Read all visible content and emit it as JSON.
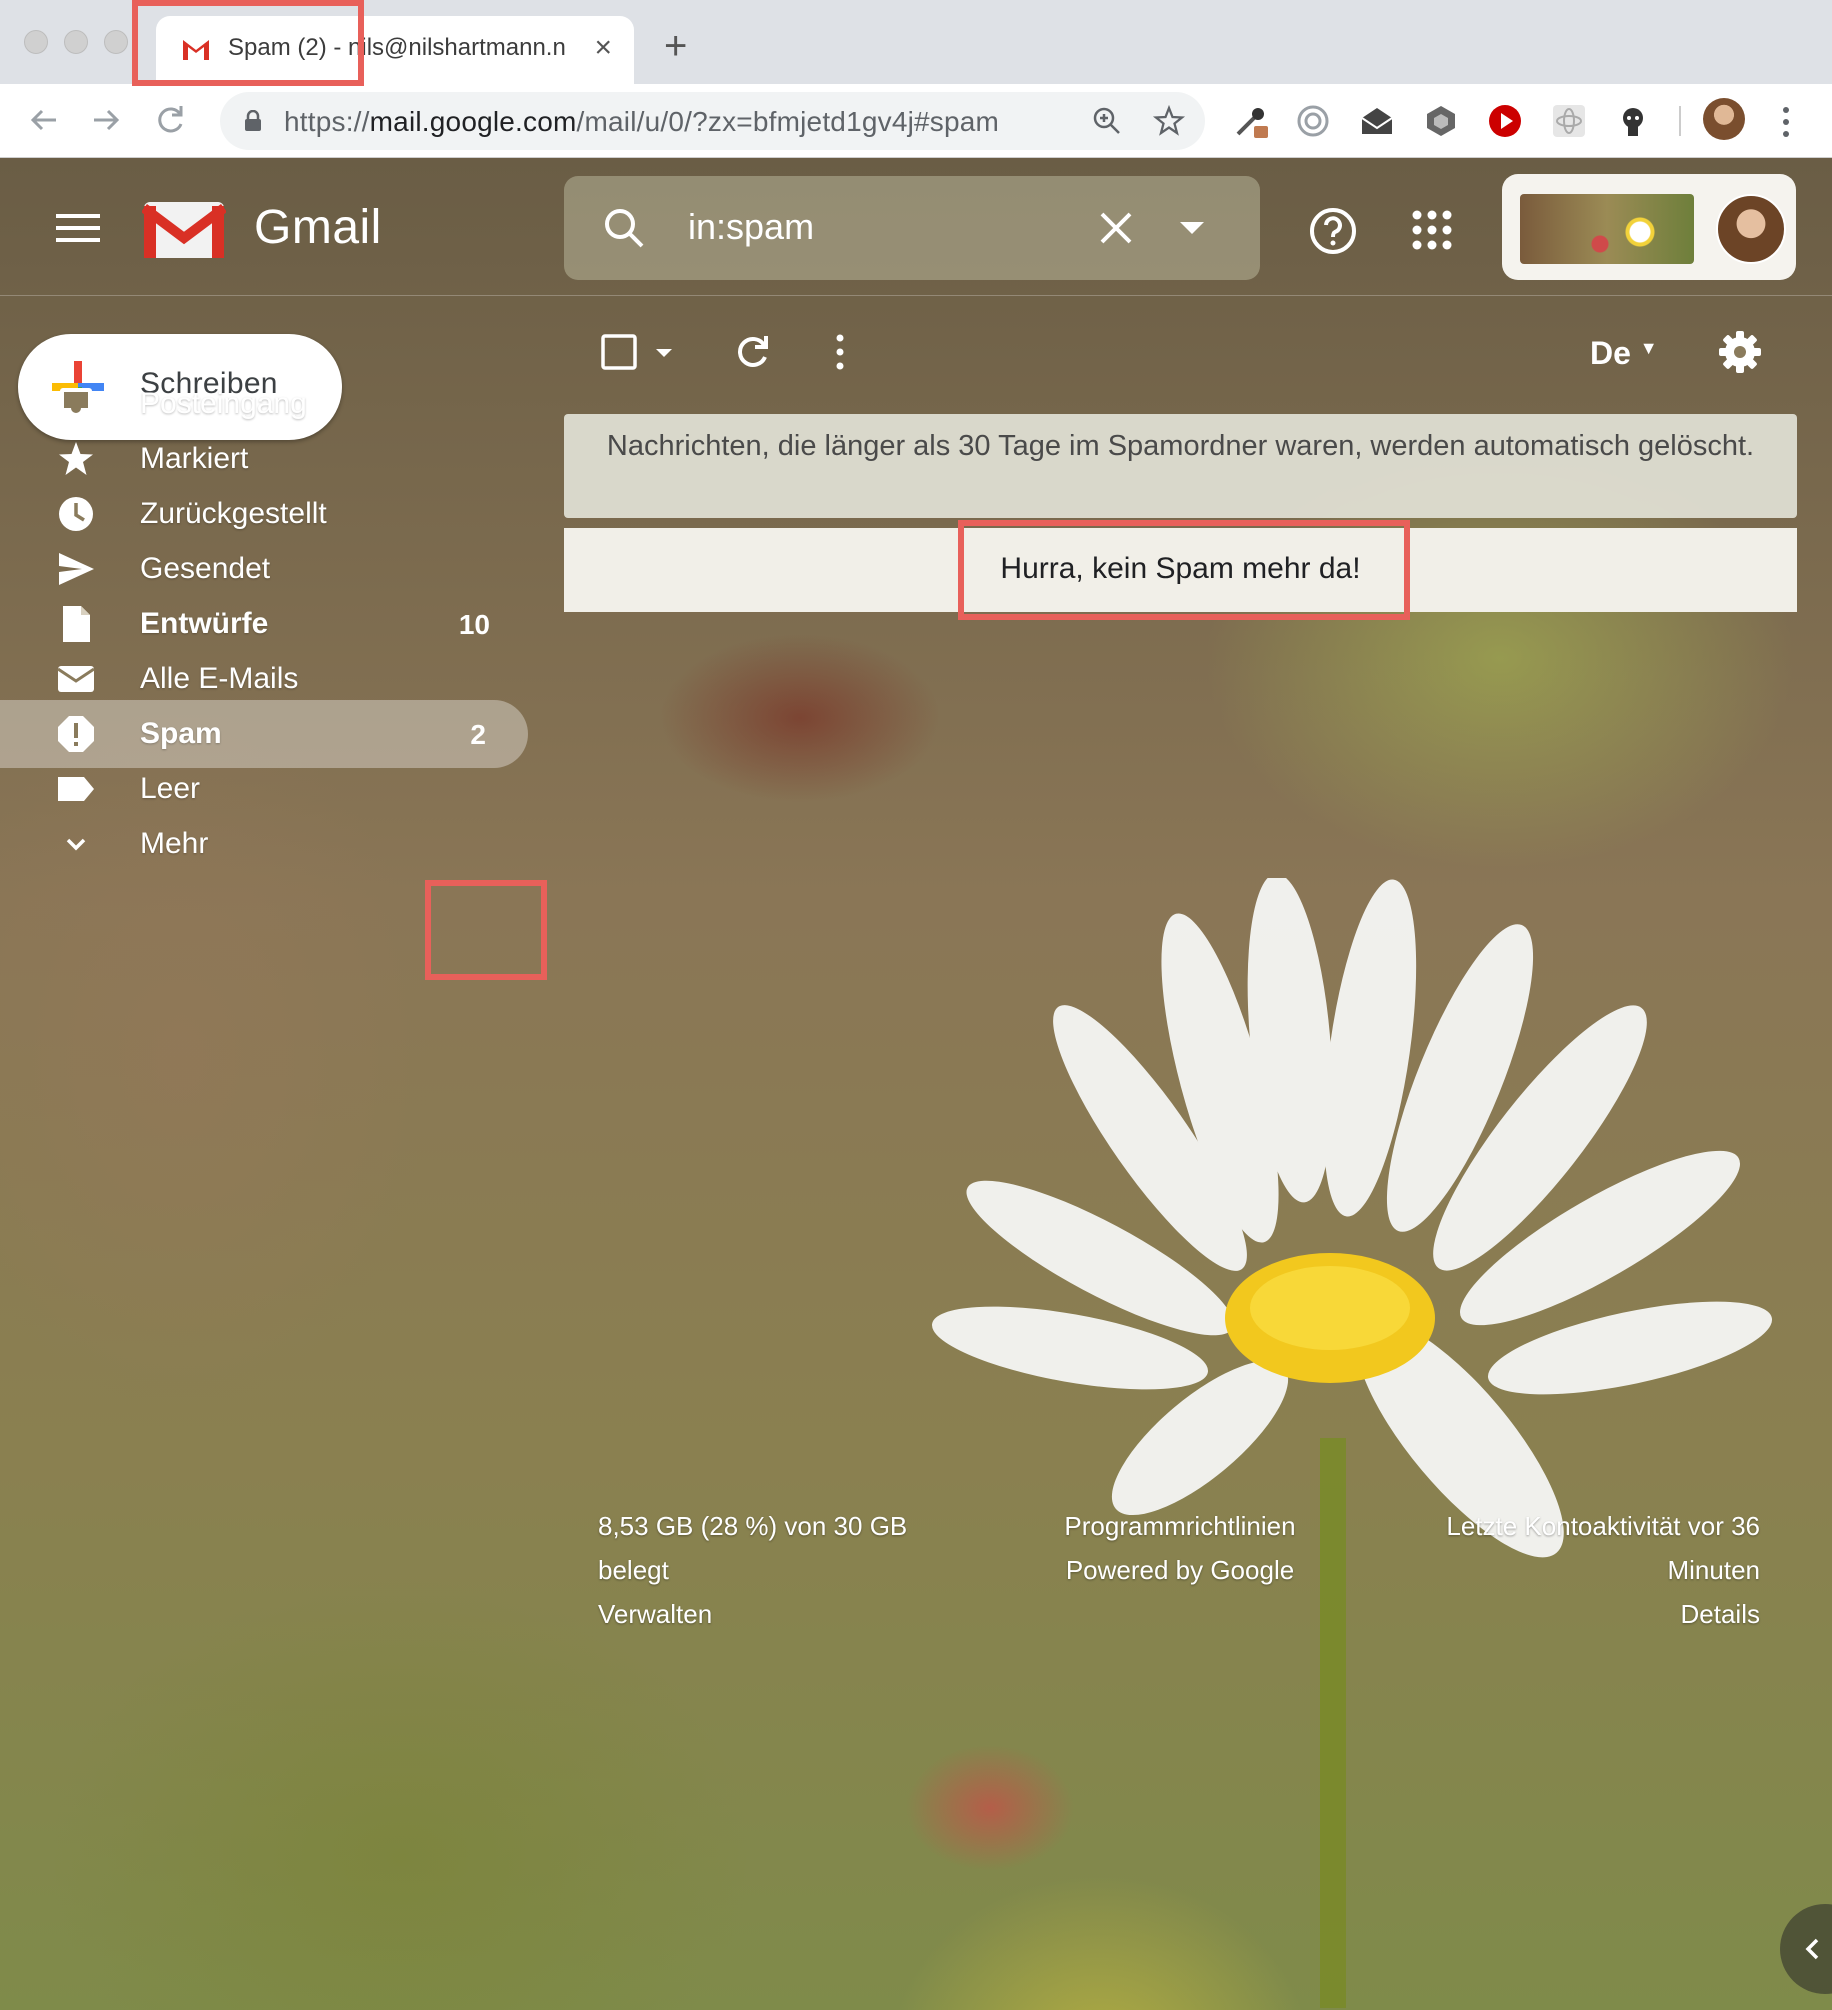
{
  "browser": {
    "tab": {
      "title": "Spam (2) - nils@nilshartmann.n",
      "close": "×"
    },
    "new_tab": "+",
    "url": {
      "scheme": "https://",
      "host": "mail.google.com",
      "path": "/mail/u/0/?zx=bfmjetd1gv4j#spam"
    }
  },
  "gmail": {
    "brand": "Gmail",
    "search": {
      "value": "in:spam"
    },
    "compose": {
      "label": "Schreiben"
    },
    "sidebar": {
      "items": [
        {
          "label": "Posteingang",
          "icon": "inbox-icon",
          "count": ""
        },
        {
          "label": "Markiert",
          "icon": "star-icon",
          "count": ""
        },
        {
          "label": "Zurückgestellt",
          "icon": "clock-icon",
          "count": ""
        },
        {
          "label": "Gesendet",
          "icon": "send-icon",
          "count": ""
        },
        {
          "label": "Entwürfe",
          "icon": "draft-icon",
          "count": "10"
        },
        {
          "label": "Alle E-Mails",
          "icon": "mail-icon",
          "count": ""
        },
        {
          "label": "Spam",
          "icon": "spam-icon",
          "count": "2"
        },
        {
          "label": "Leer",
          "icon": "label-icon",
          "count": ""
        },
        {
          "label": "Mehr",
          "icon": "chevron-down-icon",
          "count": ""
        }
      ]
    },
    "toolbar": {
      "input_tools": "De"
    },
    "notice": "Nachrichten, die länger als 30 Tage im Spamordner waren, werden automatisch gelöscht.",
    "empty_message": "Hurra, kein Spam mehr da!",
    "footer": {
      "storage_line1": "8,53 GB (28 %) von 30 GB",
      "storage_line2": "belegt",
      "manage": "Verwalten",
      "policies": "Programmrichtlinien",
      "powered": "Powered by Google",
      "activity_line1": "Letzte Kontoaktivität vor 36",
      "activity_line2": "Minuten",
      "details": "Details"
    }
  },
  "colors": {
    "highlight": "#e8605a",
    "gmail_red": "#d93025"
  }
}
